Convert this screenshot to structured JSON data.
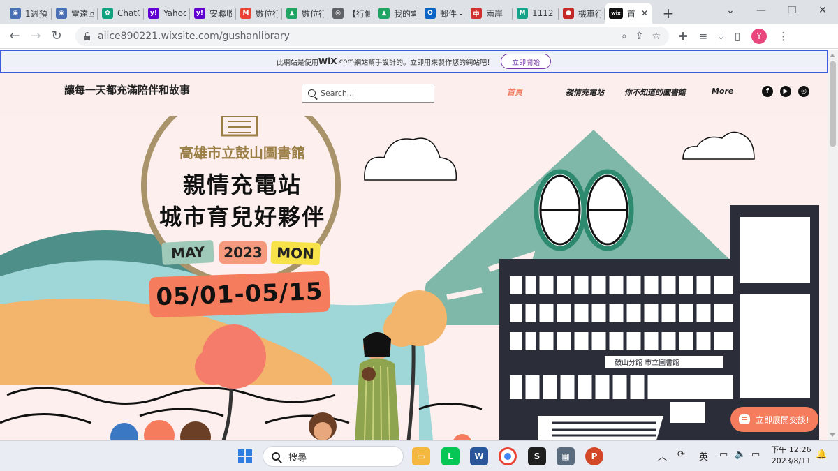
{
  "browser": {
    "tabs": [
      {
        "title": "1週預",
        "color": "#4a6fb5",
        "glyph": "◉"
      },
      {
        "title": "雷達回",
        "color": "#4a6fb5",
        "glyph": "◉"
      },
      {
        "title": "ChatG",
        "color": "#10a37f",
        "glyph": "✿"
      },
      {
        "title": "Yahoo",
        "color": "#6001d2",
        "glyph": "y!"
      },
      {
        "title": "安聯收",
        "color": "#6001d2",
        "glyph": "y!"
      },
      {
        "title": "數位行",
        "color": "#ea4335",
        "glyph": "M"
      },
      {
        "title": "數位行",
        "color": "#1fa463",
        "glyph": "▲"
      },
      {
        "title": "【行價",
        "color": "#5f6368",
        "glyph": "◎"
      },
      {
        "title": "我的雲",
        "color": "#1fa463",
        "glyph": "▲"
      },
      {
        "title": "郵件 -",
        "color": "#0a64c8",
        "glyph": "O"
      },
      {
        "title": "兩岸",
        "color": "#d32f2f",
        "glyph": "中"
      },
      {
        "title": "1112",
        "color": "#15a38a",
        "glyph": "M"
      },
      {
        "title": "機車行",
        "color": "#c62828",
        "glyph": "●"
      },
      {
        "title": "首",
        "color": "#111111",
        "glyph": "wix",
        "active": true
      }
    ],
    "new_tab": "+",
    "url": "alice890221.wixsite.com/gushanlibrary",
    "profile_initial": "Y"
  },
  "wix_banner": {
    "text_before": "此網站是使用",
    "brand": "WiX",
    "brand_suffix": ".com",
    "text_after": "網站幫手設計的。立即用來製作您的網站吧！",
    "button": "立即開始"
  },
  "site": {
    "tagline": "讓每一天都充滿陪伴和故事",
    "search_placeholder": "Search...",
    "nav": [
      {
        "label": "首頁",
        "active": true
      },
      {
        "label": "親情充電站"
      },
      {
        "label": "你不知道的圖書館"
      },
      {
        "label": "More"
      }
    ],
    "social": [
      {
        "name": "facebook",
        "glyph": "f"
      },
      {
        "name": "youtube",
        "glyph": "▶"
      },
      {
        "name": "instagram",
        "glyph": "◎"
      }
    ],
    "hero": {
      "library": "高雄市立鼓山圖書館",
      "title_line1": "親情充電站",
      "title_line2": "城市育兒好夥伴",
      "month": "MAY",
      "year": "2023",
      "day": "MON",
      "date_range": "05/01-05/15",
      "building_sign": "鼓山分館 市立圖書館"
    },
    "chat_button": "立即展開交談!"
  },
  "taskbar": {
    "search_text": "搜尋",
    "ime": "英",
    "time": "下午 12:26",
    "date": "2023/8/11"
  }
}
